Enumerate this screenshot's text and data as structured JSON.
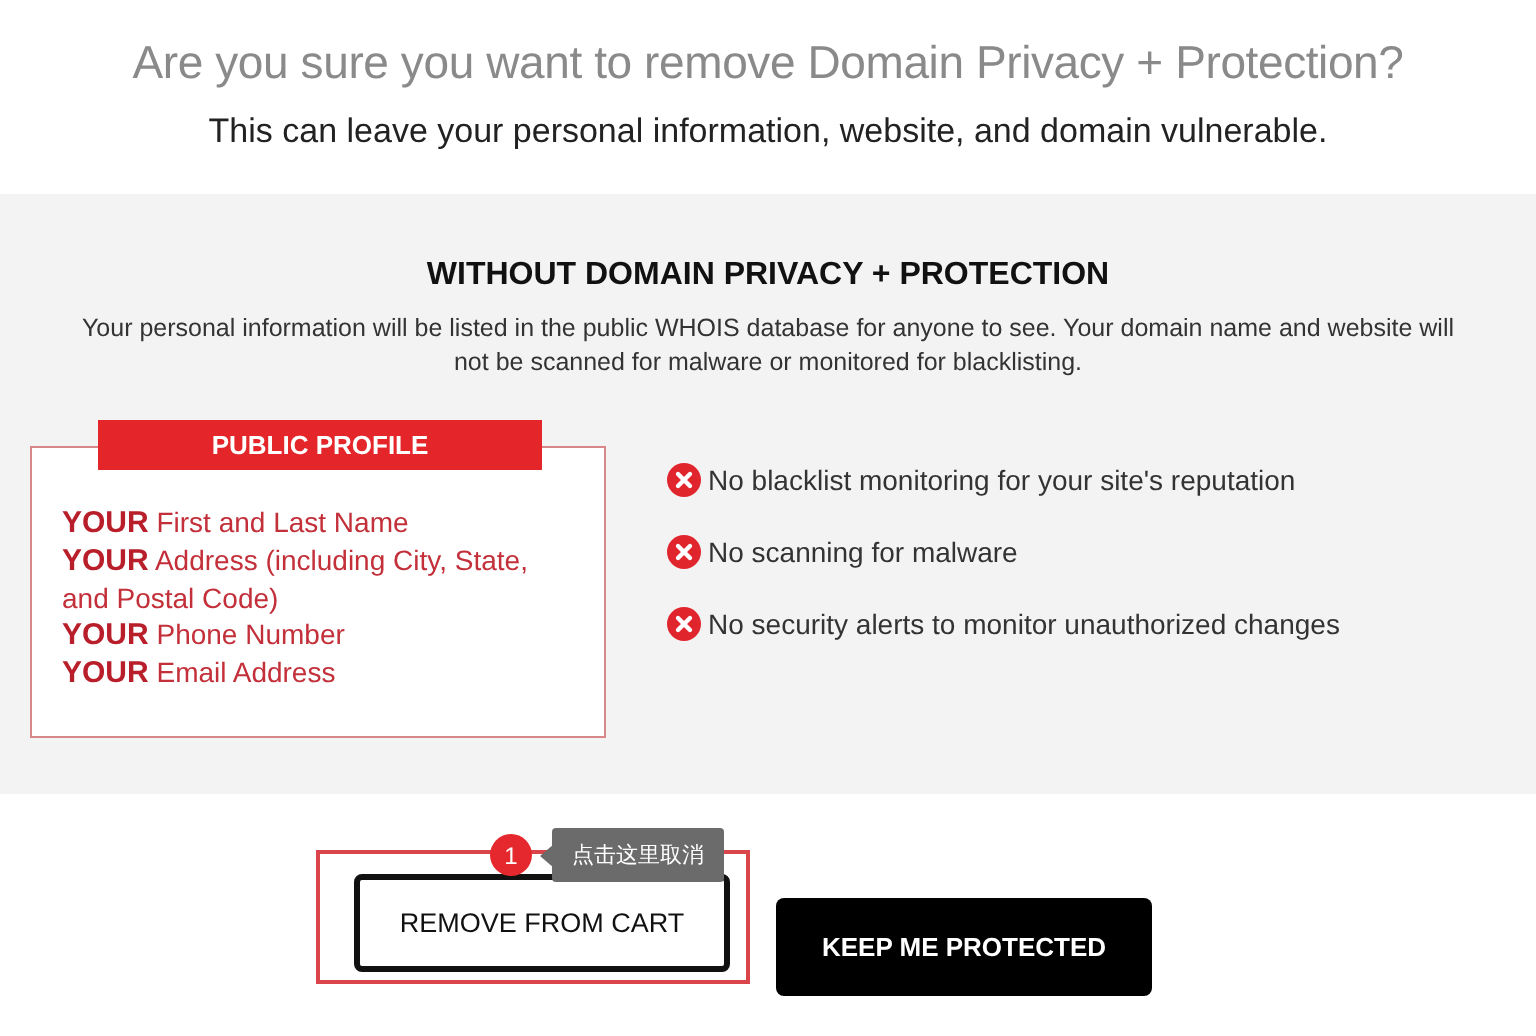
{
  "header": {
    "title": "Are you sure you want to remove Domain Privacy + Protection?",
    "subtitle": "This can leave your personal information, website, and domain vulnerable."
  },
  "panel": {
    "heading": "WITHOUT DOMAIN PRIVACY + PROTECTION",
    "description": "Your personal information will be listed in the public WHOIS database for anyone to see. Your domain name and website will not be scanned for malware or monitored for blacklisting.",
    "profile": {
      "title": "PUBLIC PROFILE",
      "items": [
        "**YOUR** First and Last Name",
        "**YOUR** Address (including City, State, and Postal Code)",
        "**YOUR** Phone Number",
        "**YOUR** Email Address"
      ]
    },
    "risks": [
      "No blacklist monitoring for your site's reputation",
      "No scanning for malware",
      "No security alerts to monitor unauthorized changes"
    ]
  },
  "annotation": {
    "number": "1",
    "text": "点击这里取消"
  },
  "buttons": [
    {
      "label": "REMOVE FROM CART",
      "kind": "outline",
      "highlighted": true
    },
    {
      "label": "KEEP ME PROTECTED",
      "kind": "solid",
      "highlighted": false
    }
  ]
}
